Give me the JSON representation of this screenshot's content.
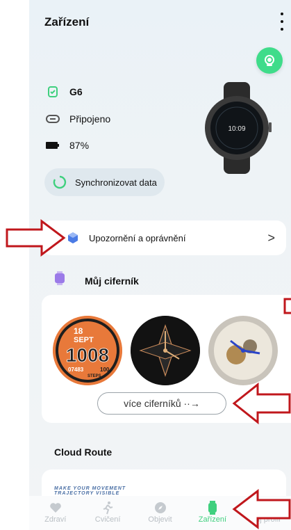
{
  "header": {
    "title": "Zařízení"
  },
  "device": {
    "name": "G6",
    "status": "Připojeno",
    "battery": "87%",
    "battery_level": 0.87,
    "sync_label": "Synchronizovat data",
    "watch_time": "10:09"
  },
  "notifications": {
    "label": "Upozornění a oprávnění"
  },
  "watchfaces": {
    "title": "Můj ciferník",
    "more_label": "více ciferníků ··→",
    "face1": {
      "day": "18",
      "month": "SEPT",
      "time": "1008",
      "steps_label": "STEPS",
      "steps": "07483",
      "pct": "100"
    }
  },
  "cloud_route": {
    "title": "Cloud Route",
    "banner_line1": "MAKE YOUR MOVEMENT",
    "banner_line2": "TRAJECTORY VISIBLE"
  },
  "tabs": [
    {
      "label": "Zdraví",
      "icon": "heart-icon"
    },
    {
      "label": "Cvičení",
      "icon": "running-icon"
    },
    {
      "label": "Objevit",
      "icon": "compass-icon"
    },
    {
      "label": "Zařízení",
      "icon": "watch-icon"
    },
    {
      "label": "Můj profil",
      "icon": "profile-icon"
    }
  ],
  "colors": {
    "accent": "#3fdc8a",
    "annotation_arrow": "#c0171c"
  }
}
